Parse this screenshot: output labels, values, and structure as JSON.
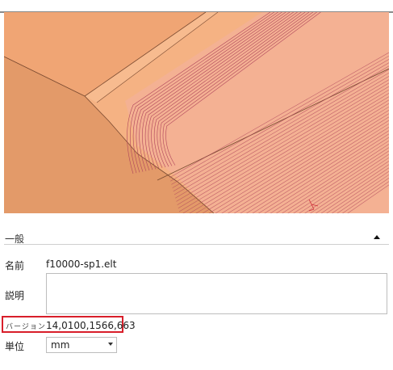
{
  "section": {
    "title": "一般",
    "collapse_icon": "chevron-up-icon"
  },
  "properties": {
    "name_label": "名前",
    "name_value": "f10000-sp1.elt",
    "description_label": "説明",
    "description_value": "",
    "version_label": "バージョン",
    "version_value": "14,0100,1566,663",
    "unit_label": "単位",
    "unit_value": "mm"
  },
  "colors": {
    "surface_base": "#f2a877",
    "surface_shadow": "#e39a69",
    "toolpath": "#b0455c",
    "highlight_border": "#d81e2a"
  }
}
